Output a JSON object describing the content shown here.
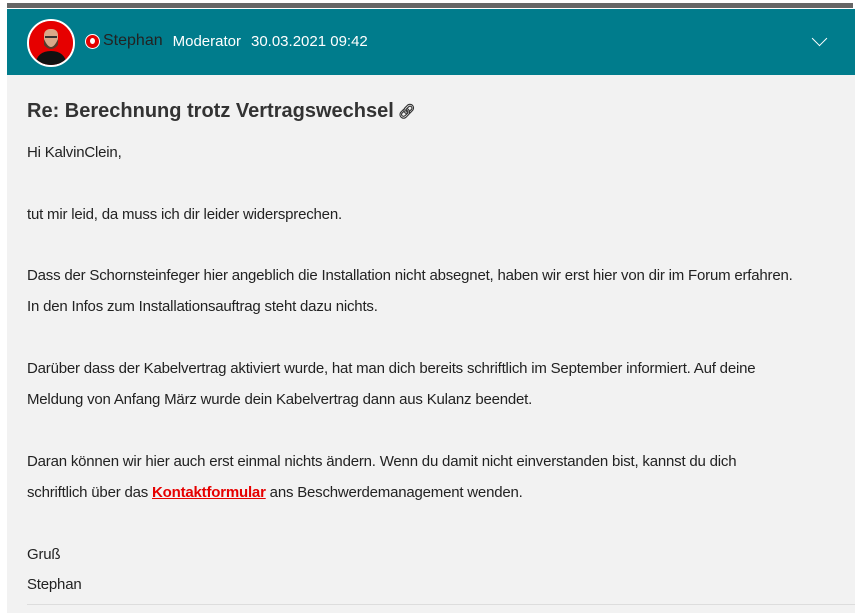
{
  "post": {
    "author": "Stephan",
    "role": "Moderator",
    "timestamp": "30.03.2021 09:42",
    "title": "Re: Berechnung trotz Vertragswechsel",
    "body": {
      "greeting": "Hi KalvinClein,",
      "p1": "tut mir leid, da muss ich dir leider widersprechen.",
      "p2a": "Dass der Schornsteinfeger hier angeblich die Installation nicht absegnet, haben wir erst hier von dir im Forum erfahren.",
      "p2b": "In den Infos zum Installationsauftrag steht dazu nichts.",
      "p3a": "Darüber dass der Kabelvertrag aktiviert wurde, hat man dich bereits schriftlich im September informiert. Auf deine",
      "p3b": "Meldung von Anfang März wurde dein Kabelvertrag dann aus Kulanz beendet.",
      "p4a": "Daran können wir hier auch erst einmal nichts ändern. Wenn du damit nicht einverstanden bist, kannst du dich",
      "p4b_pre": "schriftlich über das ",
      "p4b_link": "Kontaktformular",
      "p4b_post": " ans Beschwerdemanagement wenden.",
      "closing": "Gruß",
      "signature": "Stephan"
    }
  },
  "colors": {
    "header": "#007c8c",
    "brand_red": "#e60000",
    "content_bg": "#f2f2f2"
  }
}
